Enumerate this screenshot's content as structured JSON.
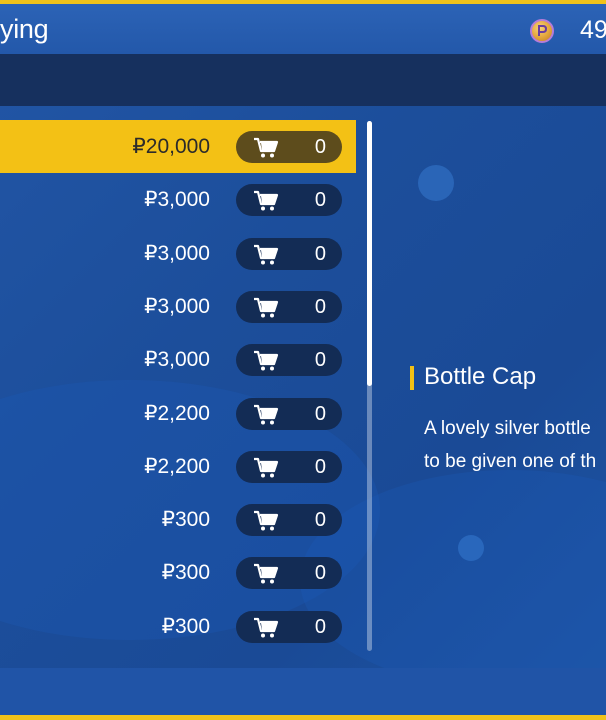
{
  "header": {
    "title": "ying",
    "money_icon": "currency-coin-icon",
    "money": "49"
  },
  "items": [
    {
      "price": "₽20,000",
      "qty": "0",
      "selected": true
    },
    {
      "price": "₽3,000",
      "qty": "0",
      "selected": false
    },
    {
      "price": "₽3,000",
      "qty": "0",
      "selected": false
    },
    {
      "price": "₽3,000",
      "qty": "0",
      "selected": false
    },
    {
      "price": "₽3,000",
      "qty": "0",
      "selected": false
    },
    {
      "price": "₽2,200",
      "qty": "0",
      "selected": false
    },
    {
      "price": "₽2,200",
      "qty": "0",
      "selected": false
    },
    {
      "price": "₽300",
      "qty": "0",
      "selected": false
    },
    {
      "price": "₽300",
      "qty": "0",
      "selected": false
    },
    {
      "price": "₽300",
      "qty": "0",
      "selected": false
    }
  ],
  "detail": {
    "title": "Bottle Cap",
    "desc_line1": "A lovely silver bottle",
    "desc_line2": "to be given one of th"
  },
  "colors": {
    "accent": "#f3c115",
    "background": "#1c4e9b",
    "pill": "#132c55"
  }
}
